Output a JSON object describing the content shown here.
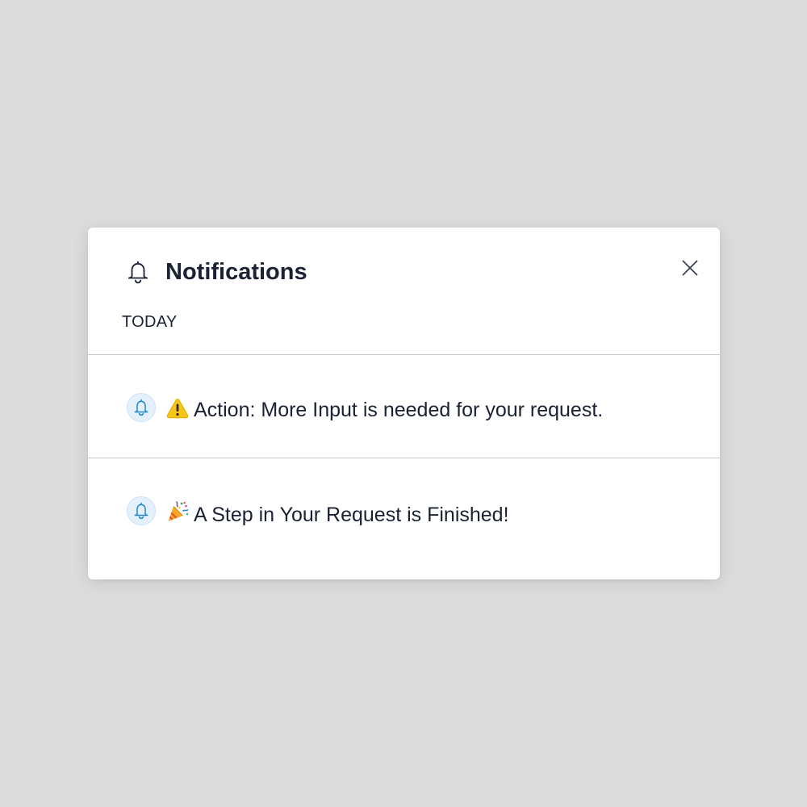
{
  "panel": {
    "title": "Notifications",
    "header_icon": "bell-icon",
    "close_icon": "close-icon",
    "section_label": "TODAY"
  },
  "notifications": [
    {
      "icon": "bell-icon",
      "emoji_icon": "warning-icon",
      "text": "Action: More Input is needed for your request."
    },
    {
      "icon": "bell-icon",
      "emoji_icon": "party-popper-icon",
      "text": "A Step in Your Request is Finished!"
    }
  ],
  "colors": {
    "background": "#dcdcdc",
    "panel": "#ffffff",
    "text": "#1a2233",
    "divider": "#c6c8cc",
    "icon_badge_bg": "#e4f0fb",
    "icon_badge_stroke": "#1e88d6",
    "warning": "#f5c518"
  }
}
